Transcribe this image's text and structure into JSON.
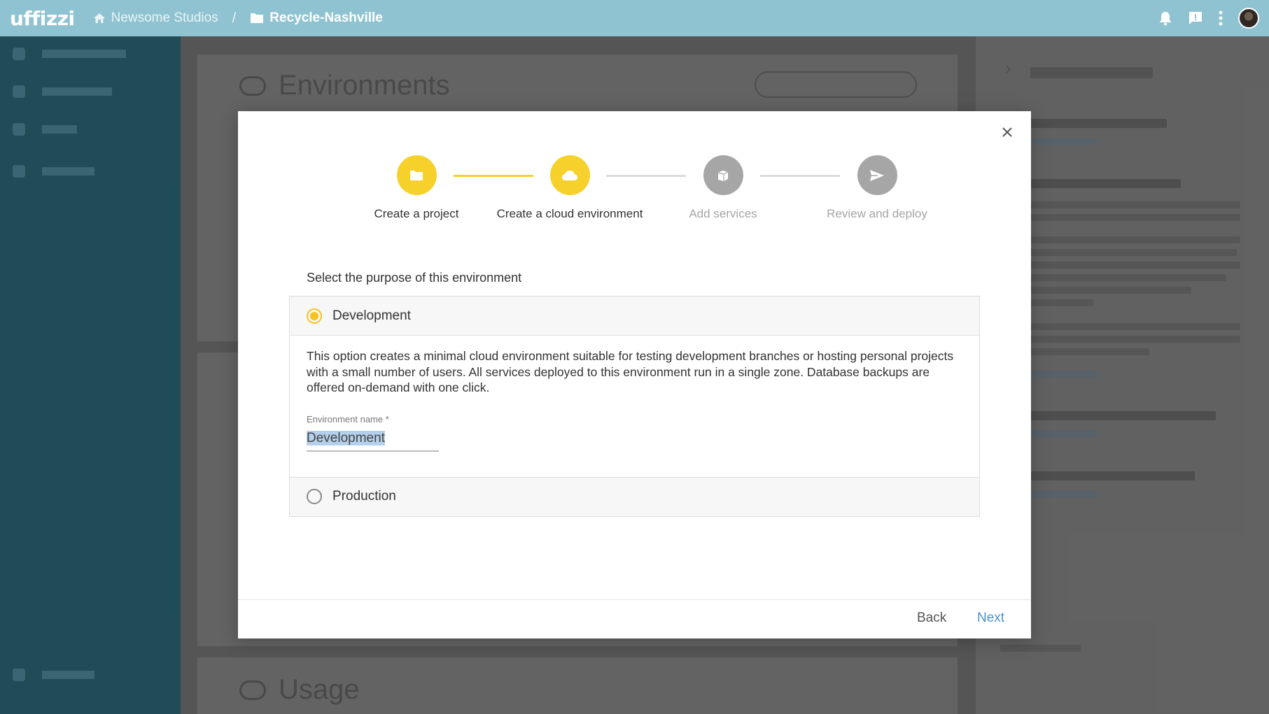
{
  "app": {
    "logo": "uffizzi"
  },
  "breadcrumb": {
    "org": "Newsome Studios",
    "separator": "/",
    "project": "Recycle-Nashville"
  },
  "background": {
    "card_environments_title": "Environments",
    "card_usage_title": "Usage"
  },
  "wizard": {
    "steps": [
      {
        "label": "Create a project",
        "state": "complete",
        "icon": "folder-icon"
      },
      {
        "label": "Create a cloud environment",
        "state": "active",
        "icon": "cloud-icon"
      },
      {
        "label": "Add services",
        "state": "inactive",
        "icon": "cube-icon"
      },
      {
        "label": "Review and deploy",
        "state": "inactive",
        "icon": "send-icon"
      }
    ],
    "prompt": "Select the purpose of this environment",
    "options": [
      {
        "label": "Development",
        "selected": true,
        "description": "This option creates a minimal cloud environment suitable for testing development branches or hosting personal projects with a small number of users. All services deployed to this environment run in a single zone. Database backups are offered on-demand with one click.",
        "field_label": "Environment name *",
        "field_value": "Development"
      },
      {
        "label": "Production",
        "selected": false
      }
    ],
    "back_label": "Back",
    "next_label": "Next"
  },
  "colors": {
    "topbar": "#8fc3d1",
    "accent_yellow": "#f7d12b",
    "inactive_step": "#a6a6a6",
    "link_blue": "#4f93c7"
  }
}
